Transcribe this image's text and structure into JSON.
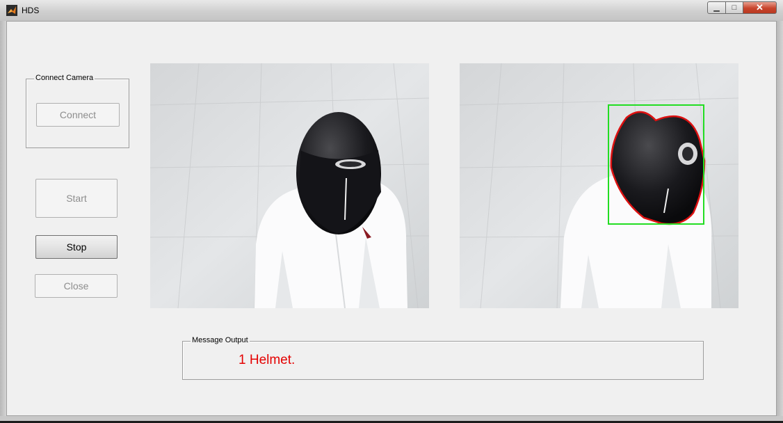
{
  "window": {
    "title": "HDS",
    "minimize": "▁",
    "maximize": "□",
    "close": "✕"
  },
  "connect_panel": {
    "title": "Connect Camera",
    "connect_label": "Connect"
  },
  "controls": {
    "start_label": "Start",
    "stop_label": "Stop",
    "close_label": "Close"
  },
  "message_panel": {
    "title": "Message Output",
    "message": "1 Helmet.",
    "message_color": "#e40000"
  },
  "colors": {
    "detection_box": "#22dd22",
    "helmet_outline": "#dd1111"
  },
  "icons": [
    "matlab-logo-icon"
  ]
}
